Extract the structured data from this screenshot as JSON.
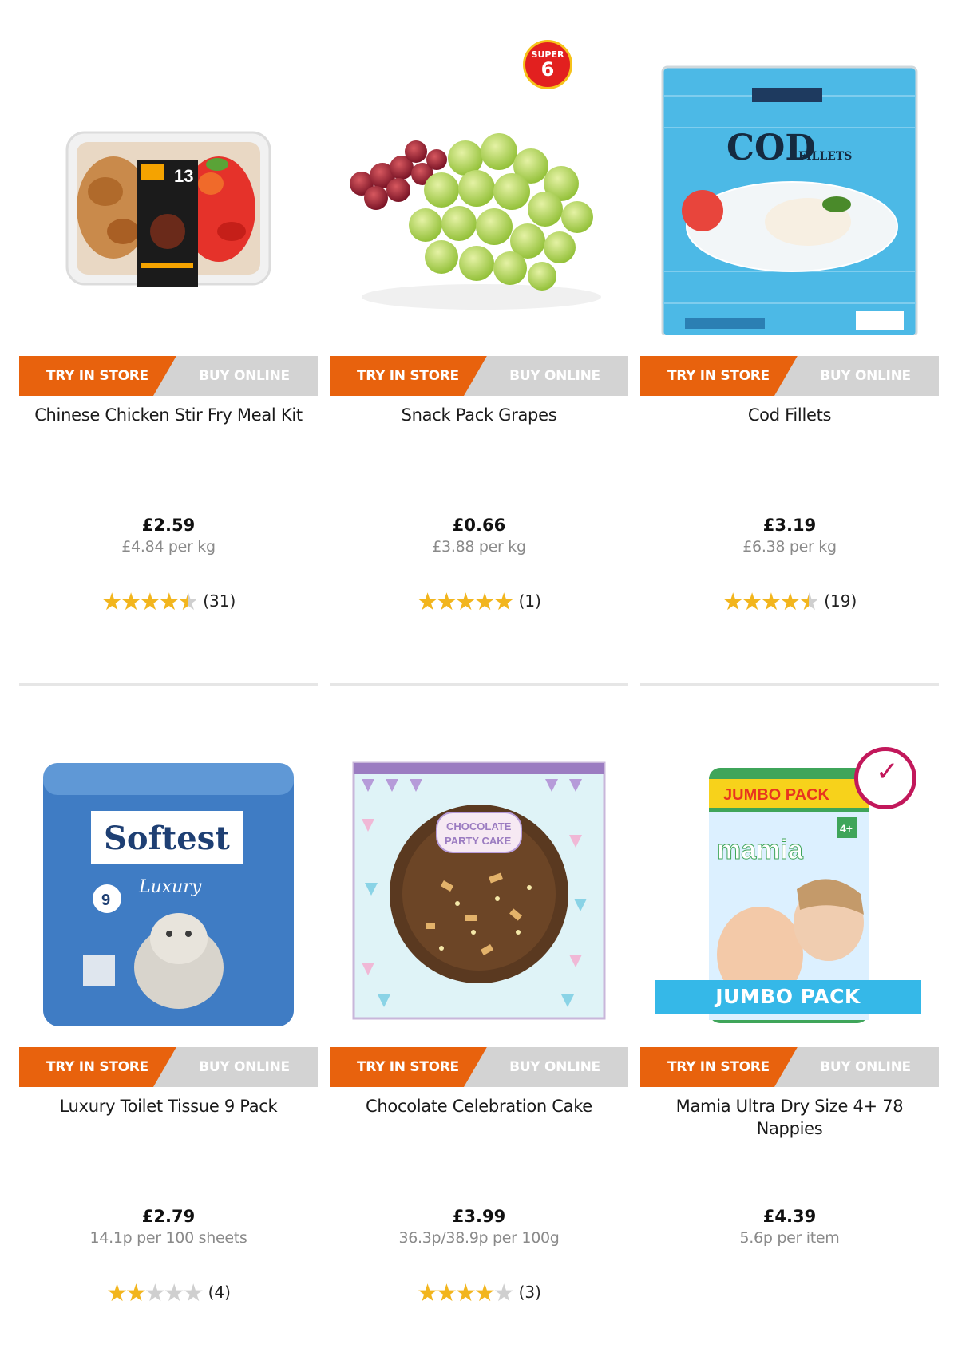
{
  "products": [
    {
      "title": "Chinese Chicken Stir Fry Meal Kit",
      "price": "£2.59",
      "unit_price": "£4.84 per kg",
      "rating": 4.5,
      "review_count": "(31)",
      "try_in_store_label": "TRY IN STORE",
      "buy_online_label": "BUY ONLINE",
      "image": "meal-kit-tray"
    },
    {
      "title": "Snack Pack Grapes",
      "price": "£0.66",
      "unit_price": "£3.88 per kg",
      "rating": 5,
      "review_count": "(1)",
      "try_in_store_label": "TRY IN STORE",
      "buy_online_label": "BUY ONLINE",
      "image": "grapes",
      "badge": {
        "line1": "SUPER",
        "line2": "6"
      }
    },
    {
      "title": "Cod Fillets",
      "price": "£3.19",
      "unit_price": "£6.38 per kg",
      "rating": 4.5,
      "review_count": "(19)",
      "try_in_store_label": "TRY IN STORE",
      "buy_online_label": "BUY ONLINE",
      "image": "cod-fillets-bag"
    },
    {
      "title": "Luxury Toilet Tissue 9 Pack",
      "price": "£2.79",
      "unit_price": "14.1p per 100 sheets",
      "rating": 2,
      "review_count": "(4)",
      "try_in_store_label": "TRY IN STORE",
      "buy_online_label": "BUY ONLINE",
      "image": "toilet-tissue-pack"
    },
    {
      "title": "Chocolate Celebration Cake",
      "price": "£3.99",
      "unit_price": "36.3p/38.9p per 100g",
      "rating": 4,
      "review_count": "(3)",
      "try_in_store_label": "TRY IN STORE",
      "buy_online_label": "BUY ONLINE",
      "image": "chocolate-cake-box"
    },
    {
      "title": "Mamia Ultra Dry Size 4+ 78 Nappies",
      "price": "£4.39",
      "unit_price": "5.6p per item",
      "rating": 0,
      "review_count": "",
      "try_in_store_label": "TRY IN STORE",
      "buy_online_label": "BUY ONLINE",
      "image": "nappies-pack",
      "banner": "JUMBO PACK"
    }
  ],
  "colors": {
    "try_in_store": "#e8620d",
    "buy_online": "#d3d3d3",
    "star": "#f2b51d",
    "unit_text": "#8a8a8a",
    "jumbo_banner": "#35b8e8"
  }
}
